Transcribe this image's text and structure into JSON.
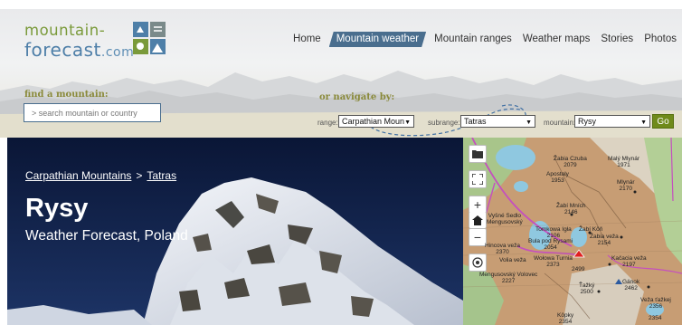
{
  "logo": {
    "line1": "mountain-",
    "line2": "forecast",
    "line2_suffix": ".com"
  },
  "nav": {
    "items": [
      {
        "label": "Home"
      },
      {
        "label": "Mountain weather",
        "active": true
      },
      {
        "label": "Mountain ranges"
      },
      {
        "label": "Weather maps"
      },
      {
        "label": "Stories"
      },
      {
        "label": "Photos"
      }
    ]
  },
  "search": {
    "label": "find a mountain:",
    "placeholder": "> search mountain or country"
  },
  "navigate": {
    "label": "or navigate by:",
    "range_label": "range:",
    "range_value": "Carpathian Moun",
    "subrange_label": "subrange:",
    "subrange_value": "Tatras",
    "mountain_label": "mountain:",
    "mountain_value": "Rysy",
    "go_label": "Go"
  },
  "hero": {
    "breadcrumb": [
      "Carpathian Mountains",
      "Tatras"
    ],
    "breadcrumb_sep": ">",
    "title": "Rysy",
    "subtitle": "Weather Forecast, Poland"
  },
  "map": {
    "controls": [
      "folder-icon",
      "fullscreen-icon",
      "zoom-in-icon",
      "home-icon",
      "zoom-out-icon",
      "locate-icon"
    ],
    "labels": [
      "Žabia Czuba",
      "2079",
      "Malý Mlynár",
      "1971",
      "Apostoly",
      "1953",
      "Mlynár",
      "2170",
      "Žabí Mních",
      "2146",
      "Vyšné Sedlo",
      "Mengusovský",
      "Tomkowa Igła",
      "2106",
      "Žabí Kôň",
      "Bula pod Rysami",
      "2054",
      "Hincova veža",
      "2370",
      "Žabia veža",
      "2154",
      "Volia veža",
      "Wołowa Turnia",
      "2373",
      "2499",
      "Kačacia veža",
      "2197",
      "Mengusovský Volovec",
      "2227",
      "Ťažký",
      "2500",
      "Gánok",
      "2462",
      "Veža ťažkej",
      "2356",
      "Kôpky",
      "2354",
      "2354"
    ]
  },
  "colors": {
    "logo_green": "#7a9a3a",
    "logo_blue": "#4e7fa8",
    "nav_active": "#4a6e8e",
    "go_button": "#6f8a1a",
    "hero_sky": "#0e1c40"
  }
}
